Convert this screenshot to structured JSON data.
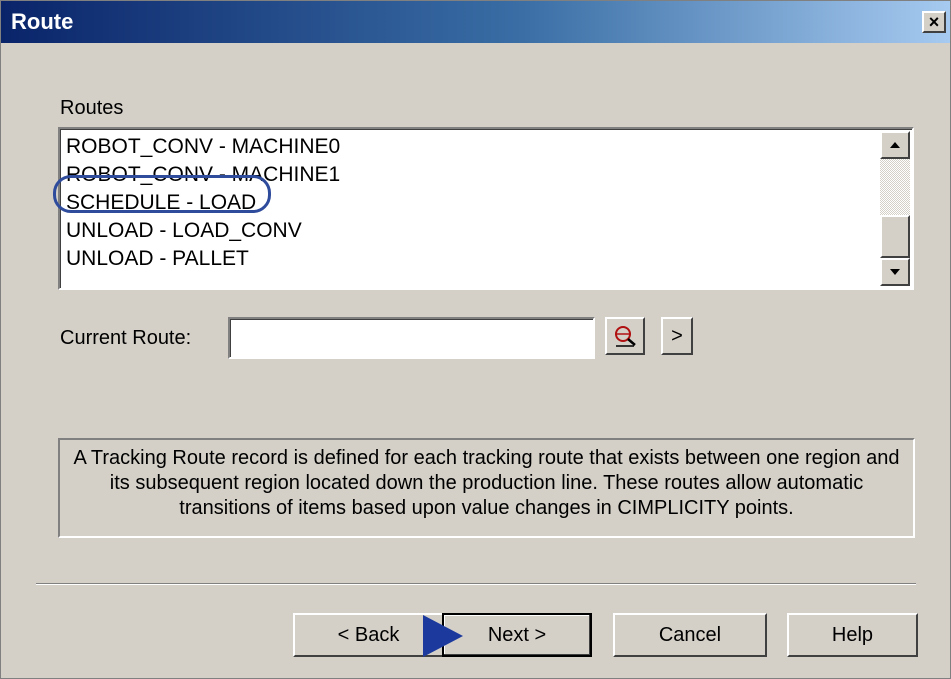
{
  "window": {
    "title": "Route",
    "close_label": "×"
  },
  "routes": {
    "label": "Routes",
    "items": [
      "ROBOT_CONV - MACHINE0",
      "ROBOT_CONV - MACHINE1",
      "SCHEDULE - LOAD",
      "UNLOAD - LOAD_CONV",
      "UNLOAD - PALLET"
    ],
    "highlighted_item": "SCHEDULE - LOAD"
  },
  "current_route": {
    "label": "Current Route:",
    "value": "",
    "more_label": ">"
  },
  "description": "A Tracking Route record is defined for each tracking route that exists between one region and its subsequent region located down the production line.  These routes allow automatic transitions of items based upon value changes in CIMPLICITY points.",
  "buttons": {
    "back": "< Back",
    "next": "Next >",
    "cancel": "Cancel",
    "help": "Help"
  },
  "colors": {
    "dialog_bg": "#d4d0c8",
    "title_start": "#0a246a",
    "title_end": "#a6caf0",
    "highlight_ring": "#2e4b9c",
    "pointer": "#1c3a9e"
  },
  "icons": {
    "browse": "browse-search-icon",
    "close": "close-icon",
    "pointer": "pointer-arrow-icon"
  }
}
